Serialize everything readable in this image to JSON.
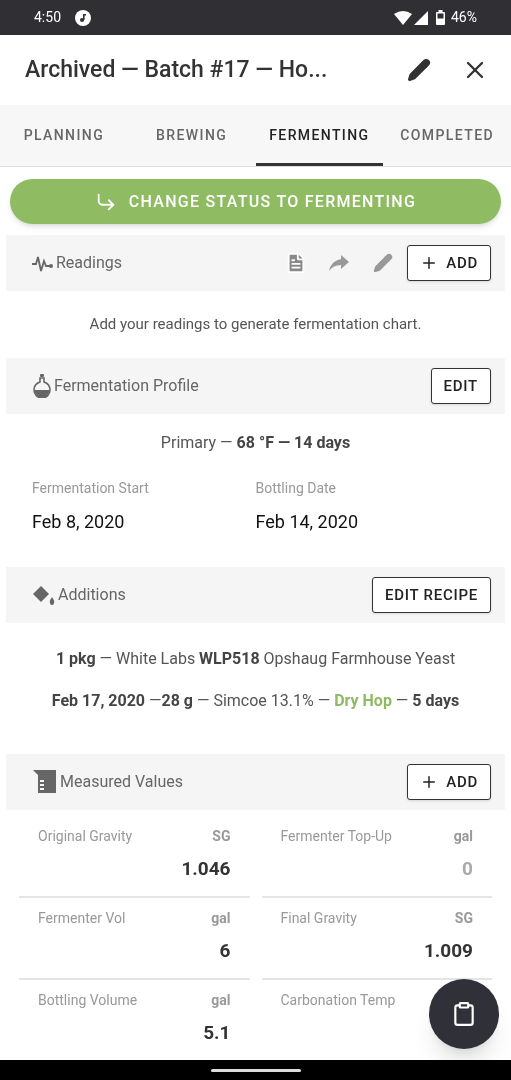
{
  "status_bar": {
    "time": "4:50",
    "battery": "46%"
  },
  "header": {
    "title": "Archived — Batch #17 — Ho..."
  },
  "tabs": [
    {
      "label": "PLANNING",
      "selected": false
    },
    {
      "label": "BREWING",
      "selected": false
    },
    {
      "label": "FERMENTING",
      "selected": true
    },
    {
      "label": "COMPLETED",
      "selected": false
    }
  ],
  "status_button": {
    "label": "CHANGE STATUS TO FERMENTING"
  },
  "readings": {
    "title": "Readings",
    "add_button": "ADD",
    "empty_message": "Add your readings to generate fermentation chart."
  },
  "fermentation_profile": {
    "title": "Fermentation Profile",
    "edit_button": "EDIT",
    "summary": "Primary — **68 °F — 14 days**",
    "dates": [
      {
        "label": "Fermentation Start",
        "value": "Feb 8, 2020"
      },
      {
        "label": "Bottling Date",
        "value": "Feb 14, 2020"
      }
    ]
  },
  "additions": {
    "title": "Additions",
    "edit_button": "EDIT RECIPE",
    "items": [
      {
        "before": "**1 pkg** — White Labs **WLP518** Opshaug Farmhouse Yeast"
      },
      {
        "before": "**Feb 17, 2020** —**28 g** — Simcoe 13.1% — ",
        "highlight": "Dry Hop",
        "after": " — **5 days**"
      }
    ]
  },
  "measured_values": {
    "title": "Measured Values",
    "add_button": "ADD",
    "fields": [
      {
        "label": "Original Gravity",
        "unit": "SG",
        "value": "1.046"
      },
      {
        "label": "Fermenter Top-Up",
        "unit": "gal",
        "placeholder": "0"
      },
      {
        "label": "Fermenter Vol",
        "unit": "gal",
        "value": "6"
      },
      {
        "label": "Final Gravity",
        "unit": "SG",
        "value": "1.009"
      },
      {
        "label": "Bottling Volume",
        "unit": "gal",
        "value": "5.1"
      },
      {
        "label": "Carbonation Temp"
      }
    ]
  }
}
